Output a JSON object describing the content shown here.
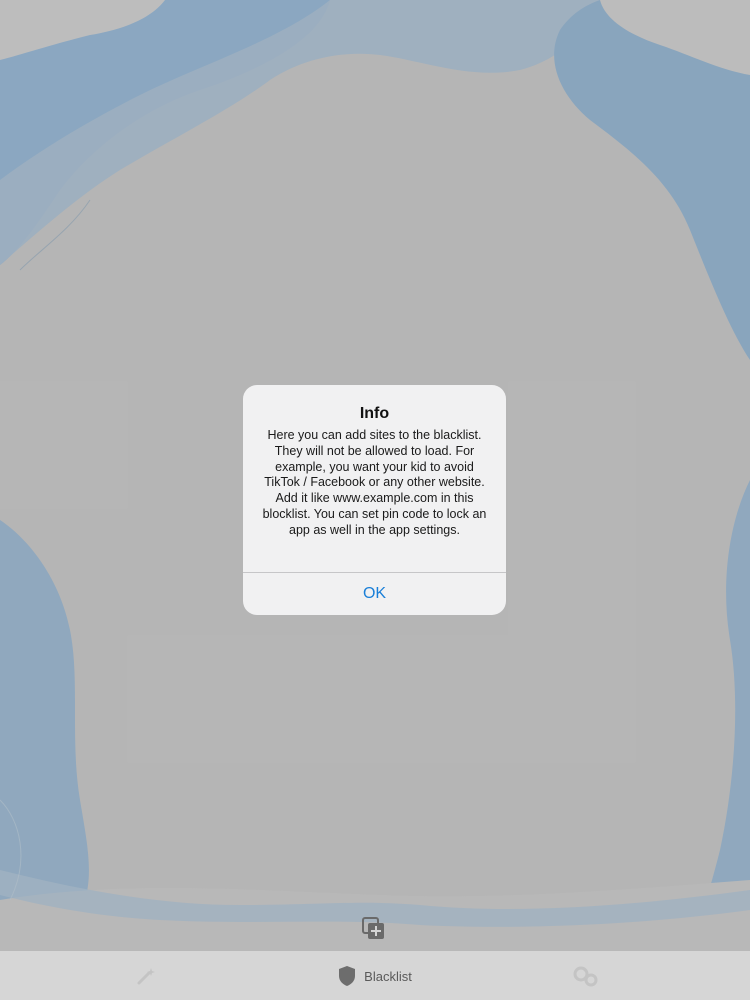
{
  "alert": {
    "title": "Info",
    "message": "Here you can add sites to the blacklist. They will not be allowed to load. For example, you want your kid to avoid TikTok / Facebook or any other website. Add it like www.example.com in this blocklist. You can set pin code to lock an app as well in the app settings.",
    "ok_label": "OK"
  },
  "toolbar": {
    "add_icon": "add-copy-icon"
  },
  "tabbar": {
    "tabs": [
      {
        "label": "",
        "icon": "magic-wand-icon",
        "selected": false
      },
      {
        "label": "Blacklist",
        "icon": "shield-icon",
        "selected": true
      },
      {
        "label": "",
        "icon": "settings-icon",
        "selected": false
      }
    ]
  },
  "colors": {
    "background": "#cfcfcf",
    "wave_blue": "#9dbcd8",
    "accent": "#1a7fd8"
  }
}
